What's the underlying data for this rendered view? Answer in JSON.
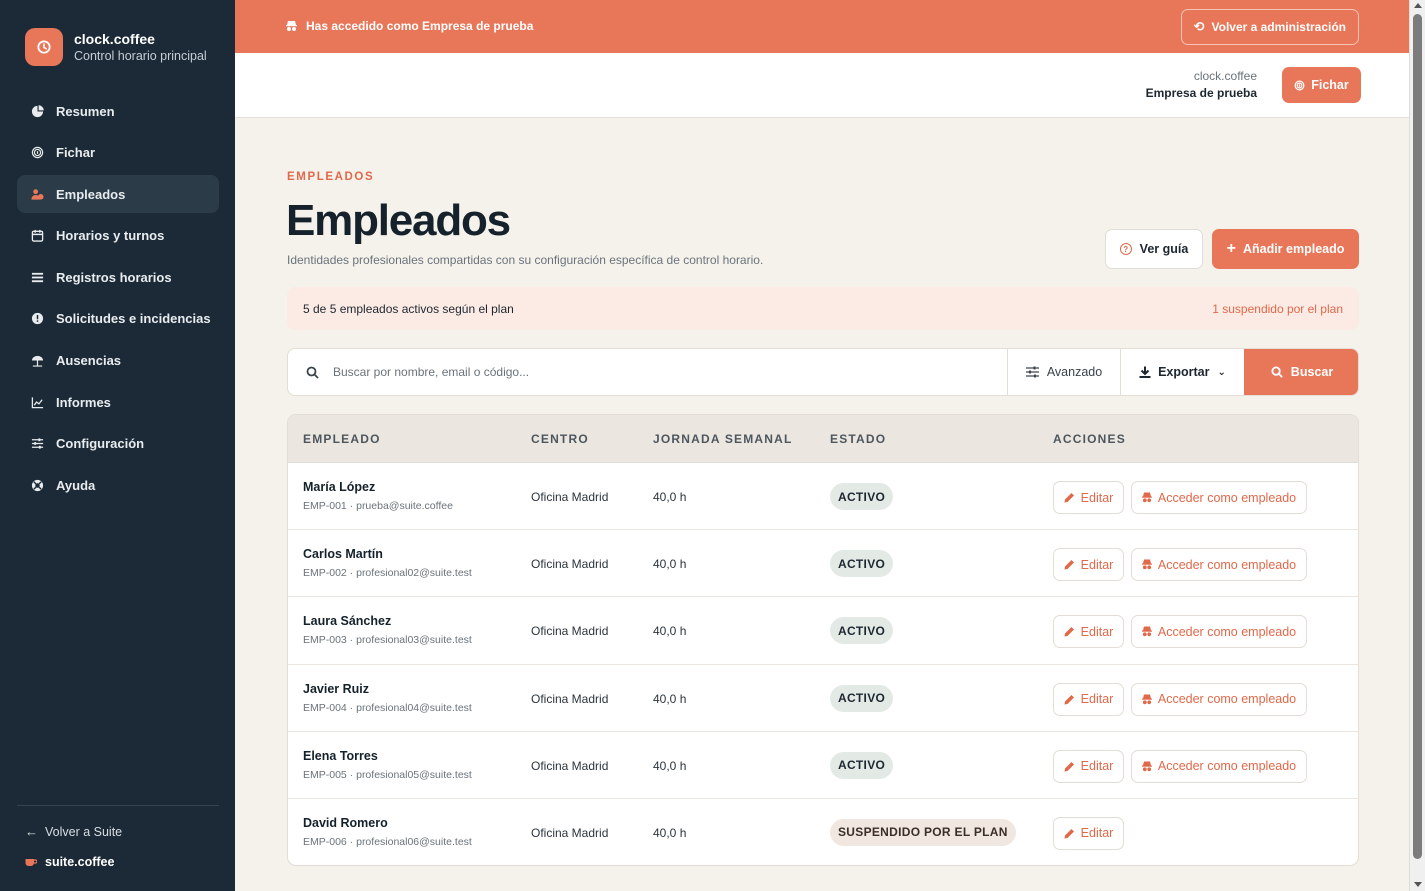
{
  "app": {
    "name": "clock.coffee",
    "subtitle": "Control horario principal"
  },
  "sidebar": {
    "items": [
      {
        "label": "Resumen",
        "icon": "pie-chart-icon"
      },
      {
        "label": "Fichar",
        "icon": "fingerprint-icon"
      },
      {
        "label": "Empleados",
        "icon": "users-icon",
        "active": true
      },
      {
        "label": "Horarios y turnos",
        "icon": "calendar-icon"
      },
      {
        "label": "Registros horarios",
        "icon": "list-icon"
      },
      {
        "label": "Solicitudes e incidencias",
        "icon": "alert-icon"
      },
      {
        "label": "Ausencias",
        "icon": "umbrella-icon"
      },
      {
        "label": "Informes",
        "icon": "chart-icon"
      },
      {
        "label": "Configuración",
        "icon": "sliders-icon"
      },
      {
        "label": "Ayuda",
        "icon": "lifebuoy-icon"
      }
    ],
    "back_label": "Volver a Suite",
    "suite_brand": "suite.coffee"
  },
  "banner": {
    "text": "Has accedido como Empresa de prueba",
    "button": "Volver a administración"
  },
  "header": {
    "org_app": "clock.coffee",
    "org_name": "Empresa de prueba",
    "fichar_label": "Fichar"
  },
  "page": {
    "eyebrow": "EMPLEADOS",
    "title": "Empleados",
    "subtitle": "Identidades profesionales compartidas con su configuración específica de control horario.",
    "guide_button": "Ver guía",
    "add_button": "Añadir empleado"
  },
  "plan": {
    "active_text": "5 de 5 empleados activos según el plan",
    "suspended_text": "1 suspendido por el plan"
  },
  "search": {
    "placeholder": "Buscar por nombre, email o código...",
    "value": "",
    "advanced_label": "Avanzado",
    "export_label": "Exportar",
    "search_label": "Buscar"
  },
  "table": {
    "columns": [
      "EMPLEADO",
      "CENTRO",
      "JORNADA SEMANAL",
      "ESTADO",
      "ACCIONES"
    ],
    "edit_label": "Editar",
    "access_label": "Acceder como empleado",
    "rows": [
      {
        "name": "María López",
        "meta": "EMP-001 · prueba@suite.coffee",
        "center": "Oficina Madrid",
        "hours": "40,0 h",
        "status": "ACTIVO"
      },
      {
        "name": "Carlos Martín",
        "meta": "EMP-002 · profesional02@suite.test",
        "center": "Oficina Madrid",
        "hours": "40,0 h",
        "status": "ACTIVO"
      },
      {
        "name": "Laura Sánchez",
        "meta": "EMP-003 · profesional03@suite.test",
        "center": "Oficina Madrid",
        "hours": "40,0 h",
        "status": "ACTIVO"
      },
      {
        "name": "Javier Ruiz",
        "meta": "EMP-004 · profesional04@suite.test",
        "center": "Oficina Madrid",
        "hours": "40,0 h",
        "status": "ACTIVO"
      },
      {
        "name": "Elena Torres",
        "meta": "EMP-005 · profesional05@suite.test",
        "center": "Oficina Madrid",
        "hours": "40,0 h",
        "status": "ACTIVO"
      },
      {
        "name": "David Romero",
        "meta": "EMP-006 · profesional06@suite.test",
        "center": "Oficina Madrid",
        "hours": "40,0 h",
        "status": "SUSPENDIDO POR EL PLAN"
      }
    ]
  },
  "colors": {
    "accent": "#e8775a",
    "sidebar": "#1b2a36",
    "background": "#f5f2ec"
  }
}
